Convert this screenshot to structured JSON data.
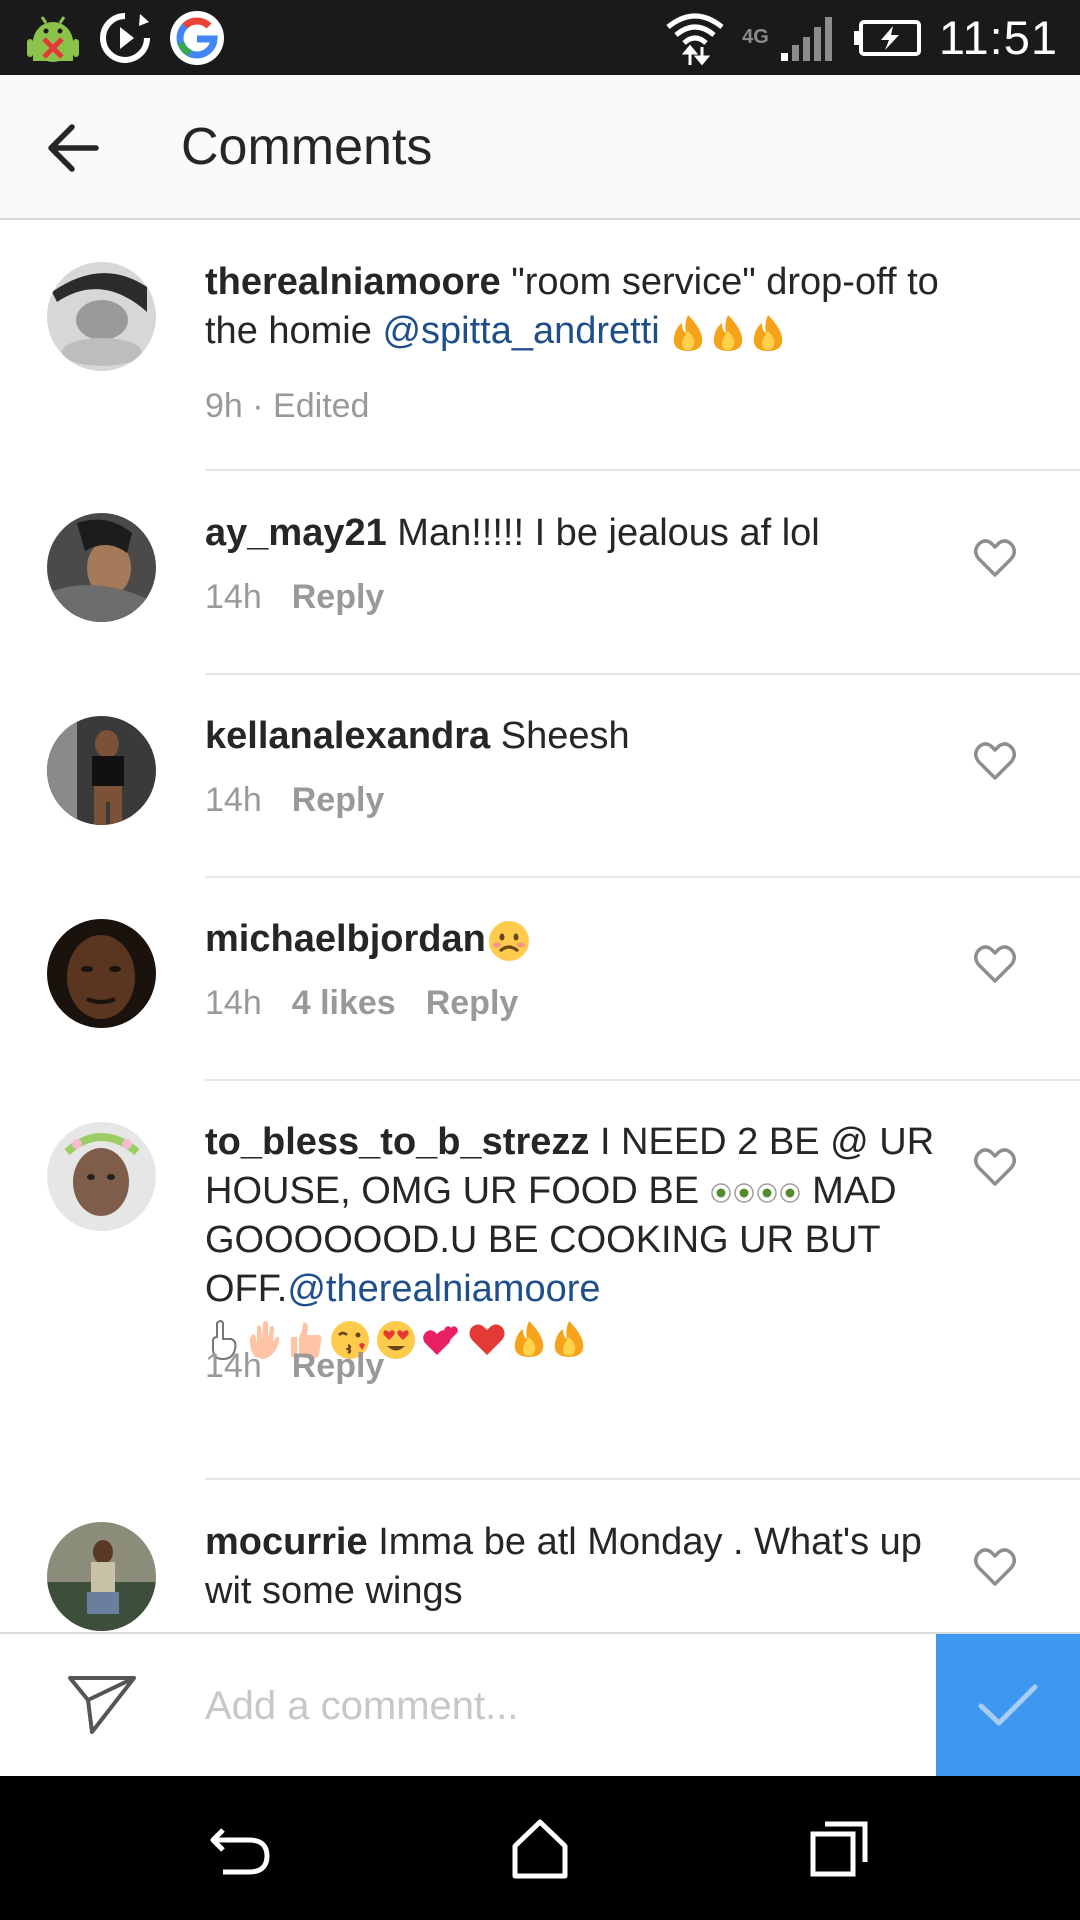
{
  "status_bar": {
    "time": "11:51",
    "network_label": "4G",
    "icons": [
      "android-debug-icon",
      "media-sync-icon",
      "google-icon",
      "wifi-icon",
      "signal-icon",
      "battery-charging-icon"
    ]
  },
  "header": {
    "title": "Comments",
    "back_icon": "arrow-left-icon"
  },
  "comments": [
    {
      "username": "therealniamoore",
      "text_before": "\"room service\" drop-off to the homie ",
      "mention": "@spitta_andretti",
      "emojis": [
        "fire",
        "fire",
        "fire"
      ],
      "time": "9h",
      "edited": "Edited",
      "is_caption": true
    },
    {
      "username": "ay_may21",
      "text": "Man!!!!! I be jealous af lol",
      "time": "14h",
      "reply": "Reply"
    },
    {
      "username": "kellanalexandra",
      "text": "Sheesh",
      "time": "14h",
      "reply": "Reply"
    },
    {
      "username": "michaelbjordan",
      "emojis": [
        "sad-face"
      ],
      "time": "14h",
      "likes": "4 likes",
      "reply": "Reply"
    },
    {
      "username": "to_bless_to_b_strezz",
      "text_before": "I NEED 2 BE @ UR HOUSE, OMG UR FOOD BE ",
      "text_after": " MAD GOOOOOOD.U BE COOKING UR BUT OFF.",
      "mention": "@therealniamoore",
      "emojis_inline": [
        "eye-eyes"
      ],
      "emojis": [
        "index-up",
        "raised-hand",
        "thumbs-up",
        "kiss-face",
        "heart-eyes",
        "two-hearts",
        "red-heart",
        "fire",
        "fire"
      ],
      "time": "14h",
      "reply": "Reply"
    },
    {
      "username": "mocurrie",
      "text": "Imma be atl Monday . What's up wit some wings"
    }
  ],
  "input": {
    "placeholder": "Add a comment..."
  },
  "colors": {
    "post_button": "#3e97f0",
    "mention": "#1f4f8a",
    "meta": "#999999"
  },
  "nav_bar": {
    "icons": [
      "back-nav-icon",
      "home-nav-icon",
      "recents-nav-icon"
    ]
  }
}
